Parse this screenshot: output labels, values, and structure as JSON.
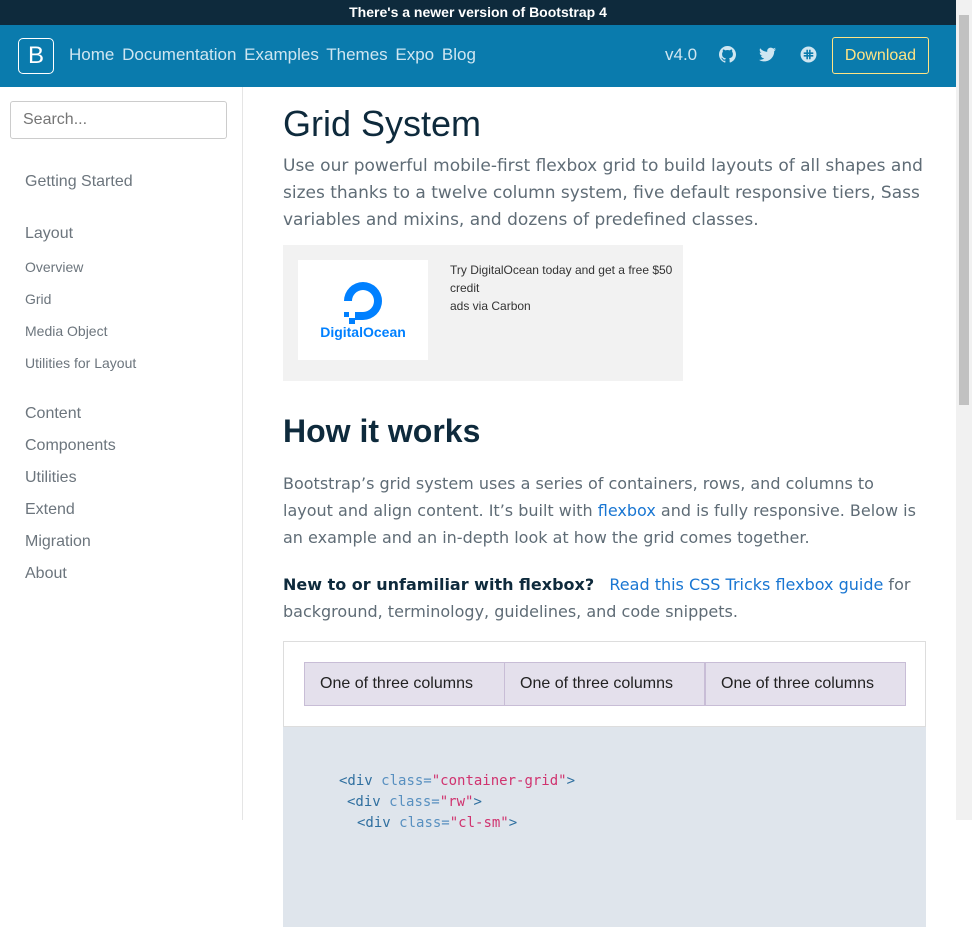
{
  "banner": {
    "text": "There's a newer version of Bootstrap 4"
  },
  "navbar": {
    "brand": "B",
    "links": [
      "Home",
      "Documentation",
      "Examples",
      "Themes",
      "Expo",
      "Blog"
    ],
    "version": "v4.0",
    "download": "Download",
    "icons": [
      "github-icon",
      "twitter-icon",
      "slack-icon"
    ]
  },
  "sidebar": {
    "search_placeholder": "Search...",
    "items": [
      {
        "label": "Getting Started"
      },
      {
        "label": "Layout"
      },
      {
        "label": "Overview"
      },
      {
        "label": "Grid"
      },
      {
        "label": "Media Object"
      },
      {
        "label": "Utilities for Layout"
      },
      {
        "label": "Content"
      },
      {
        "label": "Components"
      },
      {
        "label": "Utilities"
      },
      {
        "label": "Extend"
      },
      {
        "label": "Migration"
      },
      {
        "label": "About"
      }
    ]
  },
  "main": {
    "title": "Grid System",
    "lead": "Use our powerful mobile-first flexbox grid to build layouts of all shapes and sizes thanks to a twelve column system, five default responsive tiers, Sass variables and mixins, and dozens of predefined classes.",
    "ad": {
      "logo_text": "DigitalOcean",
      "line1": "Try DigitalOcean today and get a free $50 credit",
      "line2": "ads via Carbon"
    },
    "heading": "How it works",
    "para1": {
      "before": "Bootstrap’s grid system uses a series of containers, rows, and columns to layout and align content. It’s built with ",
      "link": "flexbox",
      "after": " and is fully responsive. Below is an example and an in-depth look at how the grid comes together."
    },
    "para2": {
      "strong": "New to or unfamiliar with flexbox?",
      "link": "Read this CSS Tricks flexbox guide",
      "after": " for background, terminology, guidelines, and code snippets."
    },
    "columns": [
      "One of three columns",
      "One of three columns",
      "One of three columns"
    ],
    "code": [
      {
        "tag": "<div",
        "attr": "class=",
        "val": "\"container-grid\"",
        "end": ">"
      },
      {
        "tag": "<div",
        "attr": "class=",
        "val": "\"rw\"",
        "end": ">"
      },
      {
        "tag": "<div",
        "attr": "class=",
        "val": "\"cl-sm\"",
        "end": ">"
      }
    ]
  },
  "colors": {
    "banner": "#0e2a3c",
    "navbar": "#0a7bad",
    "accent": "#ffe484",
    "link": "#1976d2"
  }
}
